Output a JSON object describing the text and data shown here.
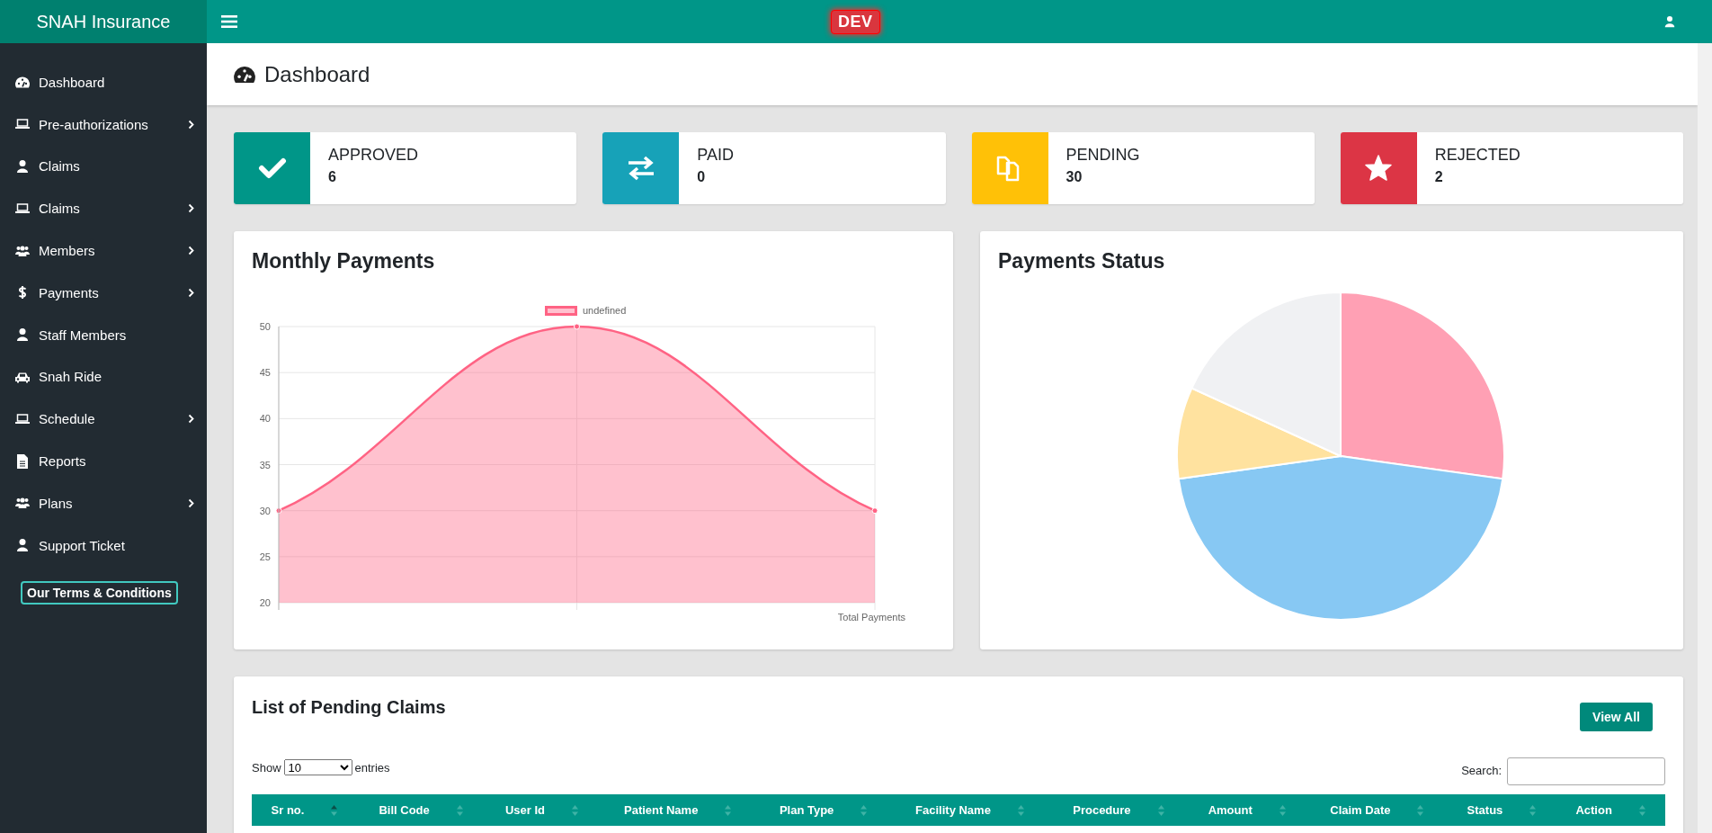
{
  "topbar": {
    "brand": "SNAH Insurance",
    "env_badge": "DEV"
  },
  "sidebar": {
    "items": [
      {
        "label": "Dashboard",
        "has_submenu": false
      },
      {
        "label": "Pre-authorizations",
        "has_submenu": true
      },
      {
        "label": "Claims",
        "has_submenu": false
      },
      {
        "label": "Claims",
        "has_submenu": true
      },
      {
        "label": "Members",
        "has_submenu": true
      },
      {
        "label": "Payments",
        "has_submenu": true
      },
      {
        "label": "Staff Members",
        "has_submenu": false
      },
      {
        "label": "Snah Ride",
        "has_submenu": false
      },
      {
        "label": "Schedule",
        "has_submenu": true
      },
      {
        "label": "Reports",
        "has_submenu": false
      },
      {
        "label": "Plans",
        "has_submenu": true
      },
      {
        "label": "Support Ticket",
        "has_submenu": false
      }
    ],
    "terms_button": "Our Terms & Conditions"
  },
  "page_header": {
    "title": "Dashboard"
  },
  "stats": [
    {
      "label": "APPROVED",
      "value": "6",
      "color": "#009688"
    },
    {
      "label": "PAID",
      "value": "0",
      "color": "#17a2b8"
    },
    {
      "label": "PENDING",
      "value": "30",
      "color": "#ffc107"
    },
    {
      "label": "REJECTED",
      "value": "2",
      "color": "#dc3545"
    }
  ],
  "monthly_payments": {
    "title": "Monthly Payments",
    "chart_data": {
      "type": "area",
      "grid": true,
      "series": [
        {
          "name": "undefined",
          "color": "#ff6384",
          "values": [
            30,
            50,
            30
          ]
        }
      ],
      "ylim": [
        20,
        50
      ],
      "yticks": [
        20,
        25,
        30,
        35,
        40,
        45,
        50
      ],
      "xlabel": "Total Payments"
    }
  },
  "payments_status": {
    "title": "Payments Status"
  },
  "pending_claims": {
    "title": "List of Pending Claims",
    "view_all_button": "View All",
    "length_menu": {
      "label_before": "Show",
      "value": "10",
      "label_after": "entries"
    },
    "search": {
      "label": "Search:"
    },
    "columns": [
      {
        "label": "Sr no.",
        "sorted": true
      },
      {
        "label": "Bill Code",
        "sorted": false
      },
      {
        "label": "User Id",
        "sorted": false
      },
      {
        "label": "Patient Name",
        "sorted": false
      },
      {
        "label": "Plan Type",
        "sorted": false
      },
      {
        "label": "Facility Name",
        "sorted": false
      },
      {
        "label": "Procedure",
        "sorted": false
      },
      {
        "label": "Amount",
        "sorted": false
      },
      {
        "label": "Claim Date",
        "sorted": false
      },
      {
        "label": "Status",
        "sorted": false
      },
      {
        "label": "Action",
        "sorted": false
      }
    ]
  }
}
